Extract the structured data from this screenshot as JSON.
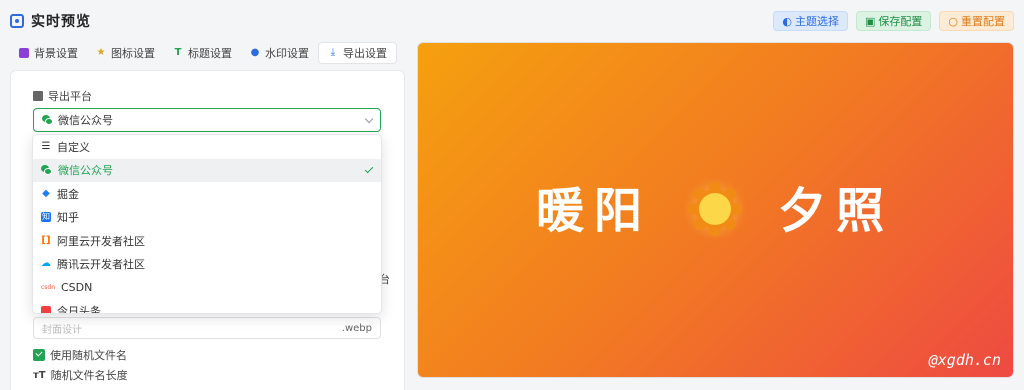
{
  "header": {
    "title": "实时预览",
    "actions": [
      {
        "label": "主题选择",
        "icon": "palette-icon"
      },
      {
        "label": "保存配置",
        "icon": "save-icon"
      },
      {
        "label": "重置配置",
        "icon": "reset-icon"
      }
    ]
  },
  "tabs": [
    {
      "label": "背景设置",
      "icon": "image-icon"
    },
    {
      "label": "图标设置",
      "icon": "star-icon"
    },
    {
      "label": "标题设置",
      "icon": "text-icon"
    },
    {
      "label": "水印设置",
      "icon": "drop-icon"
    },
    {
      "label": "导出设置",
      "icon": "download-icon",
      "active": true
    }
  ],
  "export": {
    "platform_label": "导出平台",
    "platform_value": "微信公众号",
    "options": [
      {
        "label": "自定义",
        "icon": "sliders-icon"
      },
      {
        "label": "微信公众号",
        "icon": "wechat-icon",
        "selected": true
      },
      {
        "label": "掘金",
        "icon": "juejin-icon"
      },
      {
        "label": "知乎",
        "icon": "zhihu-icon"
      },
      {
        "label": "阿里云开发者社区",
        "icon": "aliyun-icon"
      },
      {
        "label": "腾讯云开发者社区",
        "icon": "tencent-cloud-icon"
      },
      {
        "label": "CSDN",
        "icon": "csdn-icon"
      },
      {
        "label": "今日头条",
        "icon": "toutiao-icon"
      }
    ],
    "filename_placeholder": "封面设计",
    "filename_ext": ".webp",
    "random_name_label": "使用随机文件名",
    "random_length_label": "随机文件名长度",
    "partial_label": "台"
  },
  "preview": {
    "text_left": "暖阳",
    "text_right": "夕照",
    "watermark": "@xgdh.cn",
    "gradient": [
      "#f5a00f",
      "#f27a22",
      "#ee4a42"
    ]
  }
}
